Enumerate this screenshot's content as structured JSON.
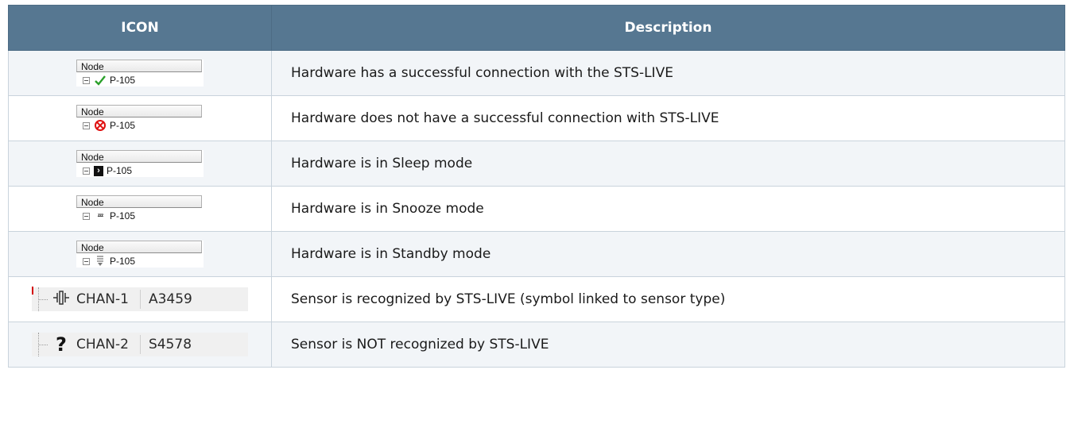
{
  "table": {
    "headers": {
      "icon": "ICON",
      "description": "Description"
    },
    "rows": [
      {
        "type": "node",
        "header": "Node",
        "label": "P-105",
        "icon": "green-check-icon",
        "description": "Hardware has a successful connection with the STS-LIVE"
      },
      {
        "type": "node",
        "header": "Node",
        "label": "P-105",
        "icon": "red-x-circle-icon",
        "description": "Hardware does not have a successful connection with STS-LIVE"
      },
      {
        "type": "node",
        "header": "Node",
        "label": "P-105",
        "icon": "sleep-icon",
        "description": "Hardware is in Sleep mode"
      },
      {
        "type": "node",
        "header": "Node",
        "label": "P-105",
        "icon": "snooze-icon",
        "description": "Hardware is in Snooze mode"
      },
      {
        "type": "node",
        "header": "Node",
        "label": "P-105",
        "icon": "standby-icon",
        "description": "Hardware is in Standby mode"
      },
      {
        "type": "channel",
        "channel": "CHAN-1",
        "id": "A3459",
        "icon": "sensor-symbol-icon",
        "description": "Sensor is recognized by STS-LIVE (symbol linked to sensor type)"
      },
      {
        "type": "channel",
        "channel": "CHAN-2",
        "id": "S4578",
        "icon": "question-mark-icon",
        "description": "Sensor is NOT recognized by STS-LIVE"
      }
    ]
  },
  "colors": {
    "header_bg": "#567791",
    "check": "#2aa02a",
    "error": "#e01010"
  }
}
